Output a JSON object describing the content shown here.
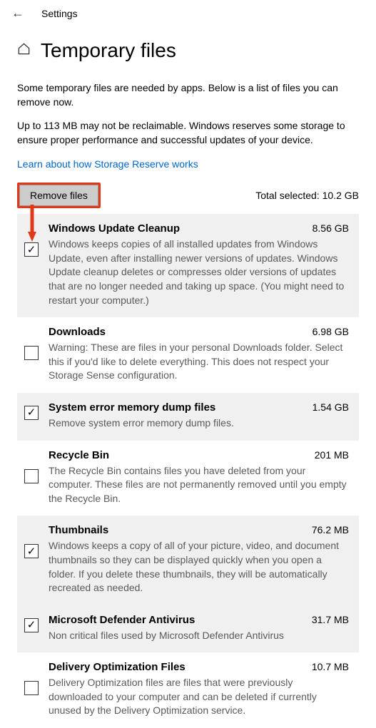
{
  "topbar": {
    "settings_label": "Settings"
  },
  "header": {
    "title": "Temporary files"
  },
  "intro": {
    "p1": "Some temporary files are needed by apps. Below is a list of files you can remove now.",
    "p2": "Up to 113 MB may not be reclaimable. Windows reserves some storage to ensure proper performance and successful updates of your device.",
    "link": "Learn about how Storage Reserve works"
  },
  "actions": {
    "remove_label": "Remove files",
    "total_prefix": "Total selected: ",
    "total_value": "10.2 GB"
  },
  "items": [
    {
      "title": "Windows Update Cleanup",
      "size": "8.56 GB",
      "checked": true,
      "shaded": true,
      "desc": "Windows keeps copies of all installed updates from Windows Update, even after installing newer versions of updates. Windows Update cleanup deletes or compresses older versions of updates that are no longer needed and taking up space. (You might need to restart your computer.)"
    },
    {
      "title": "Downloads",
      "size": "6.98 GB",
      "checked": false,
      "shaded": false,
      "desc": "Warning: These are files in your personal Downloads folder. Select this if you'd like to delete everything. This does not respect your Storage Sense configuration."
    },
    {
      "title": "System error memory dump files",
      "size": "1.54 GB",
      "checked": true,
      "shaded": true,
      "tight": true,
      "desc": "Remove system error memory dump files."
    },
    {
      "title": "Recycle Bin",
      "size": "201 MB",
      "checked": false,
      "shaded": false,
      "desc": "The Recycle Bin contains files you have deleted from your computer. These files are not permanently removed until you empty the Recycle Bin."
    },
    {
      "title": "Thumbnails",
      "size": "76.2 MB",
      "checked": true,
      "shaded": true,
      "desc": "Windows keeps a copy of all of your picture, video, and document thumbnails so they can be displayed quickly when you open a folder. If you delete these thumbnails, they will be automatically recreated as needed."
    },
    {
      "title": "Microsoft Defender Antivirus",
      "size": "31.7 MB",
      "checked": true,
      "shaded": true,
      "tight": true,
      "desc": "Non critical files used by Microsoft Defender Antivirus"
    },
    {
      "title": "Delivery Optimization Files",
      "size": "10.7 MB",
      "checked": false,
      "shaded": false,
      "desc": "Delivery Optimization files are files that were previously downloaded to your computer and can be deleted if currently unused by the Delivery Optimization service."
    }
  ],
  "annotation": {
    "highlight_color": "#e2381a"
  }
}
